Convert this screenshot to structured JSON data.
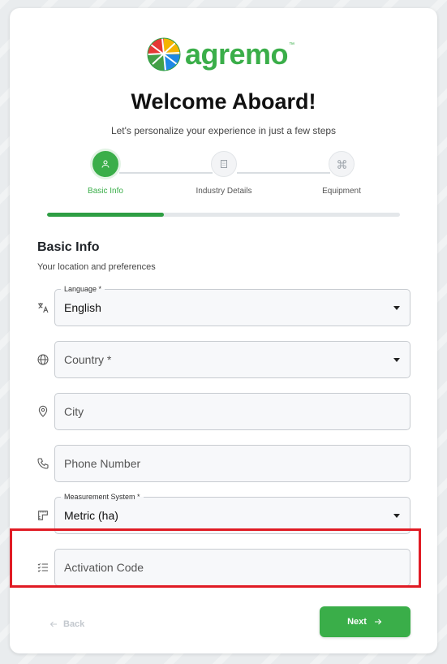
{
  "brand": {
    "name": "agremo",
    "tm": "™",
    "color": "#3aae49"
  },
  "header": {
    "title": "Welcome Aboard!",
    "subtitle": "Let's personalize your experience in just a few steps"
  },
  "stepper": {
    "steps": [
      {
        "label": "Basic Info",
        "icon": "user-icon",
        "active": true
      },
      {
        "label": "Industry Details",
        "icon": "building-icon",
        "active": false
      },
      {
        "label": "Equipment",
        "icon": "drone-icon",
        "active": false
      }
    ],
    "progress_percent": 33
  },
  "section": {
    "title": "Basic Info",
    "subtitle": "Your location and preferences"
  },
  "fields": {
    "language": {
      "label": "Language *",
      "value": "English",
      "icon": "translate-icon"
    },
    "country": {
      "placeholder": "Country *",
      "icon": "globe-icon"
    },
    "city": {
      "placeholder": "City",
      "icon": "location-pin-icon"
    },
    "phone": {
      "placeholder": "Phone Number",
      "icon": "phone-icon"
    },
    "measurement": {
      "label": "Measurement System *",
      "value": "Metric (ha)",
      "icon": "ruler-icon"
    },
    "activation": {
      "placeholder": "Activation Code",
      "icon": "checklist-icon"
    }
  },
  "actions": {
    "back_label": "Back",
    "next_label": "Next"
  },
  "colors": {
    "accent": "#3aae49",
    "highlight": "#e01b24"
  }
}
